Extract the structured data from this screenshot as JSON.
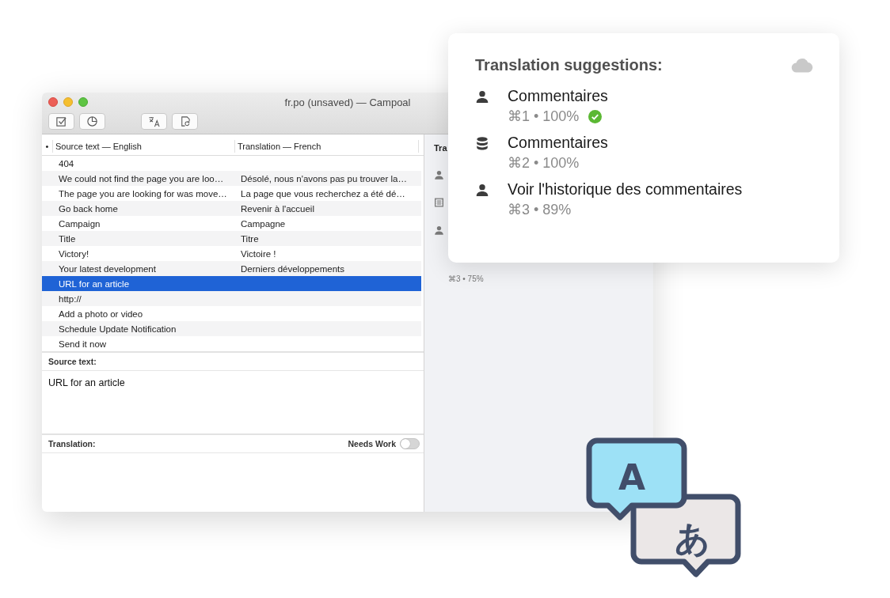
{
  "window": {
    "title": "fr.po (unsaved) — Campoal"
  },
  "toolbar": [
    {
      "kind": "check"
    },
    {
      "kind": "pie"
    },
    {
      "kind": "translate"
    },
    {
      "kind": "refresh"
    }
  ],
  "table": {
    "columns": [
      "•",
      "Source text — English",
      "Translation — French"
    ],
    "rows": [
      {
        "source": "404",
        "selected": false
      },
      {
        "source": "We could not find the page you are loo…",
        "translation": "Désolé, nous n'avons pas pu trouver la…",
        "selected": false
      },
      {
        "source": "The page you are looking for was move…",
        "translation": "La page que vous recherchez a été dé…",
        "selected": false
      },
      {
        "source": "Go back home",
        "translation": "Revenir à l'accueil",
        "selected": false
      },
      {
        "source": "Campaign",
        "translation": "Campagne",
        "selected": false
      },
      {
        "source": "Title",
        "translation": "Titre",
        "selected": false
      },
      {
        "source": "Victory!",
        "translation": "Victoire !",
        "selected": false
      },
      {
        "source": "Your latest development",
        "translation": "Derniers développements",
        "selected": false
      },
      {
        "source": "URL for an article",
        "selected": true
      },
      {
        "source": "http://",
        "selected": false
      },
      {
        "source": "Add a photo or video",
        "selected": false
      },
      {
        "source": "Schedule Update Notification",
        "selected": false
      },
      {
        "source": "Send it now",
        "selected": false
      }
    ]
  },
  "source_panel": {
    "label": "Source text:",
    "text": "URL for an article"
  },
  "translation_panel": {
    "label": "Translation:",
    "needs_work_label": "Needs Work",
    "needs_work": false
  },
  "side_pane": {
    "heading": "Tra",
    "icons": [
      {
        "kind": "person"
      },
      {
        "kind": "film"
      },
      {
        "kind": "person"
      }
    ],
    "meta": "⌘3 • 75%"
  },
  "suggestions": {
    "title": "Translation suggestions:",
    "items": [
      {
        "kind": "person",
        "text": "Commentaires",
        "meta": "⌘1 • 100%",
        "accepted": true
      },
      {
        "kind": "database",
        "text": "Commentaires",
        "meta": "⌘2 • 100%",
        "accepted": false
      },
      {
        "kind": "person",
        "text": "Voir l'historique des commentaires",
        "meta": "⌘3 • 89%",
        "accepted": false
      }
    ]
  },
  "badge": {
    "letters": [
      "A",
      "あ"
    ]
  }
}
